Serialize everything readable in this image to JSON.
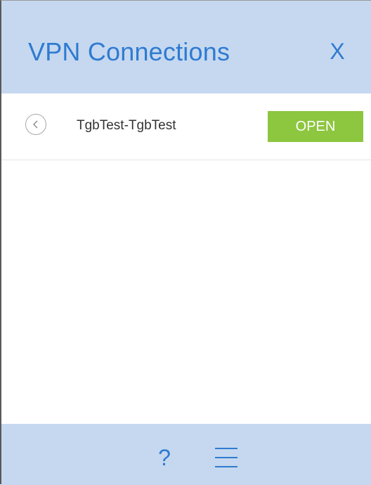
{
  "header": {
    "title": "VPN Connections",
    "close_label": "X"
  },
  "connections": [
    {
      "name": "TgbTest-TgbTest",
      "action_label": "OPEN"
    }
  ],
  "footer": {
    "help_label": "?",
    "menu_icon": "hamburger-menu-icon"
  },
  "colors": {
    "header_bg": "#c5d8f0",
    "accent": "#2f7bd0",
    "open_button": "#8dc63f"
  }
}
